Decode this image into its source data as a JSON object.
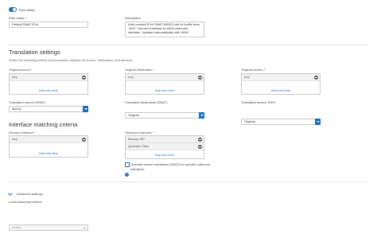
{
  "rule_status": {
    "label": "Rule status",
    "on": true
  },
  "rule_name": {
    "label": "Rule name *",
    "value": "Default SNAT IPv4"
  },
  "description": {
    "label": "Description",
    "value": "Auto-created IPv4 SNAT MASQ rule for traffic from \"ANY\" inbound interface to WAN outbound interface. Updated automatically with WAN"
  },
  "translation": {
    "title": "Translation settings",
    "help": "Select the matching criteria and translation settings for source, destination, and services.",
    "original_source": {
      "label": "Original source *",
      "items": [
        "Any"
      ],
      "add": "Add new item"
    },
    "original_destination": {
      "label": "Original destination *",
      "items": [
        "Any"
      ],
      "add": "Add new item"
    },
    "original_service": {
      "label": "Original service *",
      "items": [
        "Any"
      ],
      "add": "Add new item"
    },
    "translated_source": {
      "label": "Translated source (SNAT)",
      "value": "MASQ"
    },
    "translated_destination": {
      "label": "Translated destination (DNAT)",
      "value": "Original"
    },
    "translated_service": {
      "label": "Translated service (PAT)",
      "value": "Original"
    }
  },
  "interface": {
    "title": "Interface matching criteria",
    "inbound": {
      "label": "Inbound interface *",
      "items": [
        "Any"
      ],
      "add": "Add new item"
    },
    "outbound": {
      "label": "Outbound interface *",
      "items": [
        "Backup ISP",
        "Quantum Fiber"
      ],
      "add": "Add new item"
    },
    "override": {
      "label": "Override source translation (SNAT) for specific outbound interfaces",
      "checked": false
    }
  },
  "advanced": {
    "title": "Advanced settings",
    "lb_label": "Load balancing method",
    "lb_value": "Select"
  },
  "colors": {
    "accent": "#1d6fc4",
    "toggle": "#2a6bb4"
  },
  "icons": [
    "toggle-icon",
    "remove-icon",
    "dropdown-arrow-icon",
    "info-icon",
    "chevron-down-icon"
  ]
}
